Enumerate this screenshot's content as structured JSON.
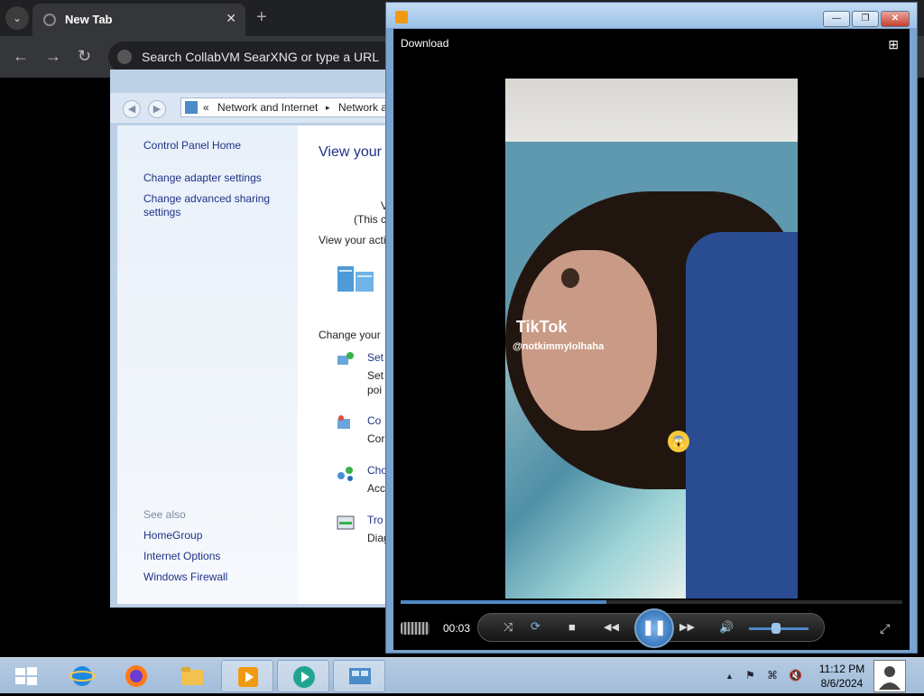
{
  "browser": {
    "tab_title": "New Tab",
    "tab_close": "✕",
    "new_tab": "+",
    "menu": "⌄",
    "back": "←",
    "forward": "→",
    "reload": "↻",
    "omnibox_placeholder": "Search CollabVM SearXNG or type a URL"
  },
  "control_panel": {
    "breadcrumbs": [
      "«",
      "Network and Internet",
      "▸",
      "Network a"
    ],
    "left_links": [
      "Control Panel Home",
      "Change adapter settings",
      "Change advanced sharing settings"
    ],
    "see_also_label": "See also",
    "see_also_links": [
      "HomeGroup",
      "Internet Options",
      "Windows Firewall"
    ],
    "heading": "View your",
    "texts": {
      "v": "V",
      "this": "(This c",
      "active": "View your acti",
      "change": "Change your",
      "set1": "Set",
      "set2": "Set",
      "poi": "poi",
      "co1": "Co",
      "co2": "Cor",
      "ch1": "Cho",
      "ch2": "Acc",
      "tr1": "Tro",
      "tr2": "Diag"
    }
  },
  "media_player": {
    "download_label": "Download",
    "layout_icon": "⊞",
    "time": "00:03",
    "progress_fraction": 0.41,
    "volume_fraction": 0.45,
    "tiktok_logo": "TikTok",
    "tiktok_user": "@notkimmylolhaha",
    "emoji": "😱",
    "controls": {
      "shuffle": "⤨",
      "repeat": "⟳",
      "stop": "■",
      "rewind": "◀◀",
      "pause": "❚❚",
      "fast_forward": "▶▶",
      "volume": "🔊",
      "fullscreen": "⤢"
    },
    "window_buttons": {
      "minimize": "—",
      "restore": "❐",
      "close": "✕"
    }
  },
  "taskbar": {
    "clock_time": "11:12 PM",
    "clock_date": "8/6/2024",
    "tray": {
      "show_hidden": "▲",
      "flag": "⚑",
      "network": "⌘",
      "volume": "🔇"
    }
  },
  "colors": {
    "ie_blue": "#1e88e5",
    "firefox_orange": "#ff7a1a",
    "explorer_yellow": "#f2c14e",
    "wmp_orange": "#f09a14",
    "player_green": "#1fa58f",
    "cp_blue": "#4b8bc7"
  }
}
